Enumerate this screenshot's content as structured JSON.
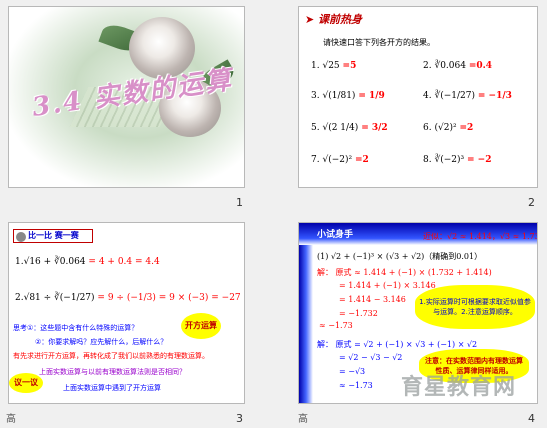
{
  "slides": {
    "s1": {
      "title": "3.4 实数的运算",
      "number": "1"
    },
    "s2": {
      "heading": "课前热身",
      "instruction": "请快速口答下列各开方的结果。",
      "items": [
        {
          "label": "1.",
          "expr": "√25",
          "answer": "=5"
        },
        {
          "label": "2.",
          "expr": "∛0.064",
          "answer": "=0.4"
        },
        {
          "label": "3.",
          "expr": "√(1/81)",
          "answer": "= 1/9"
        },
        {
          "label": "4.",
          "expr": "∛(−1/27)",
          "answer": "= −1/3"
        },
        {
          "label": "5.",
          "expr": "√(2 1/4)",
          "answer": "= 3/2"
        },
        {
          "label": "6.",
          "expr": "(√2)²",
          "answer": "=2"
        },
        {
          "label": "7.",
          "expr": "√(−2)²",
          "answer": "=2"
        },
        {
          "label": "8.",
          "expr": "∛(−2)³",
          "answer": "= −2"
        }
      ],
      "number": "2"
    },
    "s3": {
      "tag": "比一比  赛一赛",
      "line1_expr": "1.√16 + ∛0.064",
      "line1_ans": "= 4 + 0.4 = 4.4",
      "line2_expr": "2.√81 ÷ ∛(−1/27)",
      "line2_ans": "= 9 ÷ (−1/3) = 9 × (−3) = −27",
      "think": "思考①：这些题中含有什么特殊的运算？",
      "bubble1": "开方运算",
      "q2": "②：你要求解吗？应先解什么，后解什么？",
      "rule1": "有先求进行开方运算，再转化成了我们以前熟悉的有理数运算。",
      "rule2": "上面实数运算与以前有理数运算法则是否相同？",
      "bubble2": "议一议",
      "rule3": "上面实数运算中遇到了开方运算",
      "number": "3"
    },
    "s4": {
      "heading": "小试身手",
      "note": "近似：√2 ≈ 1.414，√3 ≈ 1.732",
      "problem": "(1) √2 + (−1)³ × (√3 + √2)（精确到0.01）",
      "sol_label": "解：",
      "sol1": "原式 ≈ 1.414 + (−1) × (1.732 + 1.414)",
      "sol2": "= 1.414 + (−1) × 3.146",
      "sol3": "= 1.414 − 3.146",
      "sol4": "= −1.732",
      "sol5": "≈ −1.73",
      "bubbleA": "1.实际运算时可根据要求取近似值参与运算。2.注意运算顺序。",
      "sol_b_label": "解：",
      "solb1": "原式 = √2 + (−1) × √3 + (−1) × √2",
      "solb2": "= √2 − √3 − √2",
      "solb3": "= −√3",
      "solb4": "≈ −1.73",
      "bubbleB": "注意：在实数范围内有理数运算性质、运算律同样适用。",
      "watermark": "育星教育网",
      "number": "4"
    },
    "bottom_mark": "高"
  }
}
